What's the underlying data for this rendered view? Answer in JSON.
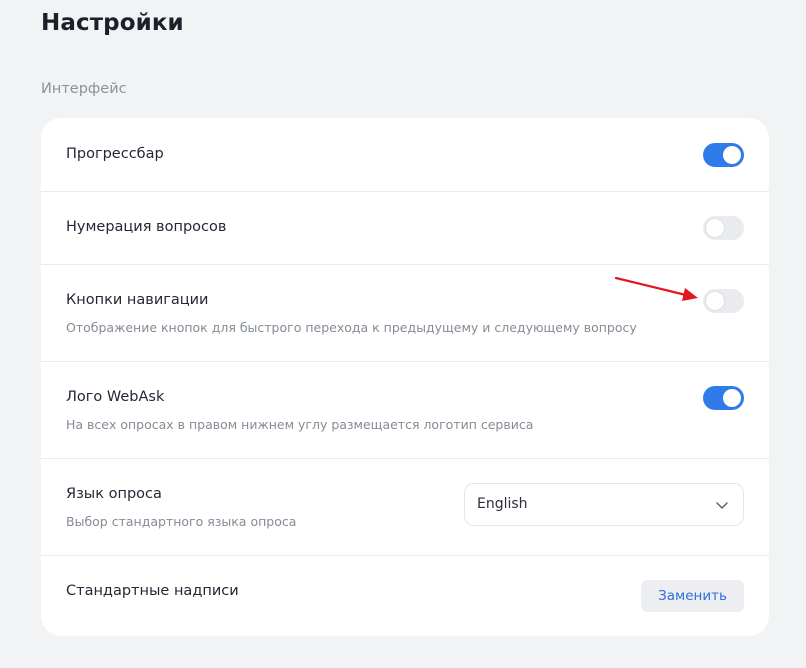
{
  "page": {
    "title": "Настройки",
    "section_label": "Интерфейс"
  },
  "settings": [
    {
      "title": "Прогрессбар",
      "description": "",
      "toggle": "on"
    },
    {
      "title": "Нумерация вопросов",
      "description": "",
      "toggle": "off"
    },
    {
      "title": "Кнопки навигации",
      "description": "Отображение кнопок для быстрого перехода к предыдущему и следующему вопросу",
      "toggle": "off"
    },
    {
      "title": "Лого WebAsk",
      "description": "На всех опросах в правом нижнем углу размещается логотип сервиса",
      "toggle": "on"
    }
  ],
  "language": {
    "title": "Язык опроса",
    "description": "Выбор стандартного языка опроса",
    "selected": "English"
  },
  "labels": {
    "title": "Стандартные надписи",
    "button_label": "Заменить"
  },
  "colors": {
    "accent": "#2f7bea",
    "annotation_arrow": "#e3171e"
  },
  "icons": {
    "select_chevron": "chevron-down-icon",
    "annotation": "red-arrow-icon"
  }
}
